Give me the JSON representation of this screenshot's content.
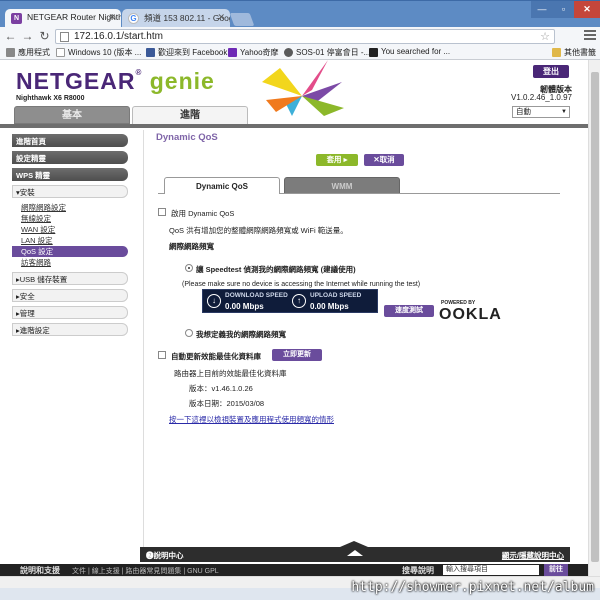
{
  "browser": {
    "tabs": [
      {
        "title": "NETGEAR Router Nighth",
        "favicon": "netgear-icon"
      },
      {
        "title": "頻道 153 802.11 - Googl",
        "favicon": "google-icon"
      }
    ],
    "url": "172.16.0.1/start.htm",
    "bookmarks": [
      {
        "label": "應用程式",
        "icon": "apps-icon"
      },
      {
        "label": "Windows 10 (版本 ...",
        "icon": "windows-icon"
      },
      {
        "label": "歡迎來到 Facebook...",
        "icon": "facebook-icon"
      },
      {
        "label": "Yahoo奇摩",
        "icon": "yahoo-icon"
      },
      {
        "label": "SOS-01 停富會日 -...",
        "icon": "sos-icon"
      },
      {
        "label": "You searched for ...",
        "icon": "generic-icon"
      },
      {
        "label": "其他書籤",
        "icon": "folder-icon"
      }
    ]
  },
  "header": {
    "brand": "NETGEAR",
    "product": "genie",
    "model": "Nighthawk X6 R8000",
    "logout": "登出",
    "firmware_label": "韌體版本",
    "firmware_version": "V1.0.2.46_1.0.97",
    "language": "自動"
  },
  "main_tabs": {
    "basic": "基本",
    "advanced": "進階"
  },
  "sidebar": {
    "top_items": [
      "進階首頁",
      "設定精靈",
      "WPS 精靈"
    ],
    "setup_group": "▾安裝",
    "setup_items": [
      "網際網路設定",
      "無線設定",
      "WAN 設定",
      "LAN 設定",
      "QoS 設定",
      "訪客網路"
    ],
    "selected_item": "QoS 設定",
    "collapsed_groups": [
      "▸USB 儲存裝置",
      "▸安全",
      "▸管理",
      "▸進階設定"
    ]
  },
  "content": {
    "title": "Dynamic QoS",
    "apply": "套用 ▸",
    "cancel": "✕取消",
    "subtabs": {
      "qos": "Dynamic QoS",
      "wmm": "WMM"
    },
    "enable_label": "啟用 Dynamic QoS",
    "description": "QoS 洪有增加您的整體網際網路頻寬或 WiFi 範送量。",
    "bandwidth_heading": "網際網路頻寬",
    "option_speedtest": "讓 Speedtest 偵測我的網際網路頻寬 (建議使用)",
    "speedtest_note": "(Please make sure no device is accessing the Internet while running the test)",
    "download_label": "DOWNLOAD SPEED",
    "download_value": "0.00 Mbps",
    "upload_label": "UPLOAD SPEED",
    "upload_value": "0.00 Mbps",
    "test_button": "速度測試",
    "powered_by": "POWERED BY",
    "ookla": "OOKLA",
    "option_manual": "我想定義我的網際網路頻寬",
    "auto_update_label": "自動更新效能最佳化資料庫",
    "update_button": "立即更新",
    "db_heading": "路由器上目前的效能最佳化資料庫",
    "db_version": "版本：v1.46.1.0.26",
    "db_date": "版本日期：2015/03/08",
    "link_text": "按一下這裡以檢視裝置及應用程式使用頻寬的情形"
  },
  "helpbar": {
    "left": "❷說明中心",
    "right": "顯示/隱藏說明中心"
  },
  "footer": {
    "title": "說明和支援",
    "links": "文件 | 線上支援 | 路由器常見問題集 | GNU GPL",
    "search_label": "搜尋說明",
    "search_placeholder": "輸入搜尋項目",
    "search_button": "前往"
  },
  "watermark": "http://showmer.pixnet.net/album"
}
